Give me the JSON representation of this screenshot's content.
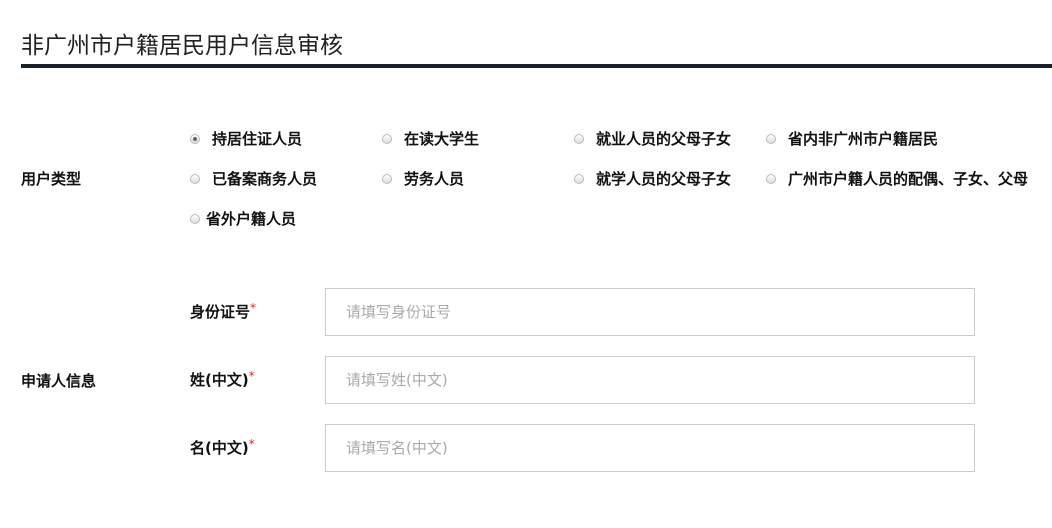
{
  "title": "非广州市户籍居民用户信息审核",
  "user_type": {
    "label": "用户类型",
    "options": [
      "持居住证人员",
      "在读大学生",
      "就业人员的父母子女",
      "省内非广州市户籍居民",
      "已备案商务人员",
      "劳务人员",
      "就学人员的父母子女",
      "广州市户籍人员的配偶、子女、父母",
      "省外户籍人员"
    ],
    "selected": "持居住证人员"
  },
  "applicant": {
    "label": "申请人信息",
    "fields": [
      {
        "label": "身份证号",
        "required": "*",
        "placeholder": "请填写身份证号",
        "value": ""
      },
      {
        "label": "姓(中文)",
        "required": "*",
        "placeholder": "请填写姓(中文)",
        "value": ""
      },
      {
        "label": "名(中文)",
        "required": "*",
        "placeholder": "请填写名(中文)",
        "value": ""
      }
    ]
  }
}
